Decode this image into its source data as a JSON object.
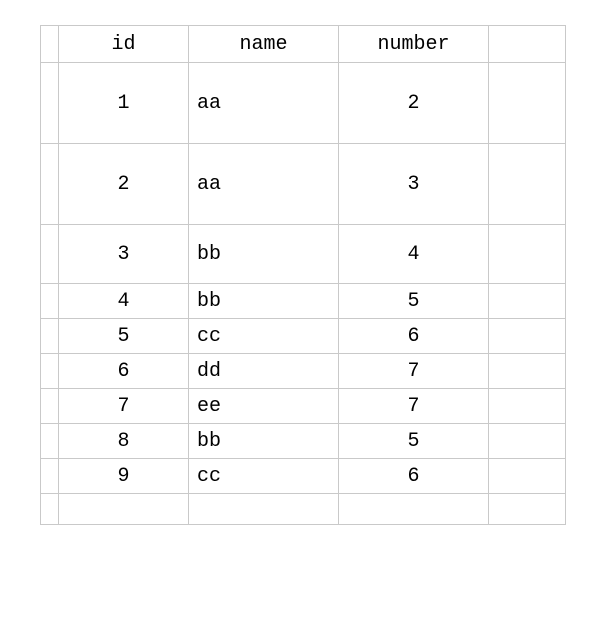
{
  "table": {
    "headers": {
      "id": "id",
      "name": "name",
      "number": "number"
    },
    "rows": [
      {
        "id": "1",
        "name": "aa",
        "number": "2"
      },
      {
        "id": "2",
        "name": "aa",
        "number": "3"
      },
      {
        "id": "3",
        "name": "bb",
        "number": "4"
      },
      {
        "id": "4",
        "name": "bb",
        "number": "5"
      },
      {
        "id": "5",
        "name": "cc",
        "number": "6"
      },
      {
        "id": "6",
        "name": "dd",
        "number": "7"
      },
      {
        "id": "7",
        "name": "ee",
        "number": "7"
      },
      {
        "id": "8",
        "name": "bb",
        "number": "5"
      },
      {
        "id": "9",
        "name": "cc",
        "number": "6"
      }
    ]
  }
}
